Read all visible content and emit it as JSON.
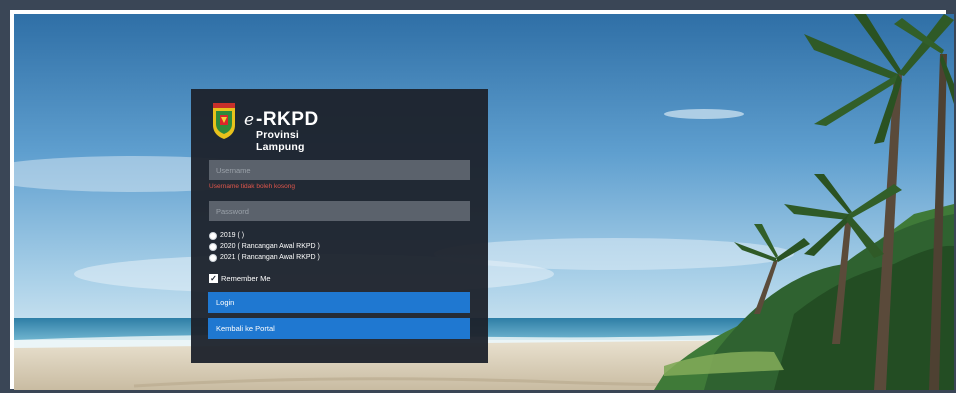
{
  "brand": {
    "e_prefix": "e",
    "name": "-RKPD",
    "subtitle": "Provinsi Lampung"
  },
  "form": {
    "username_placeholder": "Username",
    "username_error": "Username tidak boleh kosong",
    "password_placeholder": "Password",
    "years": [
      {
        "label": "2019 ( )"
      },
      {
        "label": "2020 ( Rancangan Awal RKPD )"
      },
      {
        "label": "2021 ( Rancangan Awal RKPD )"
      }
    ],
    "remember_label": "Remember Me",
    "login_label": "Login",
    "portal_label": "Kembali ke Portal"
  },
  "colors": {
    "frame": "#3a4656",
    "panel": "#1c222b",
    "input": "#5b626c",
    "error": "#e0564b",
    "button": "#1f78d1"
  }
}
